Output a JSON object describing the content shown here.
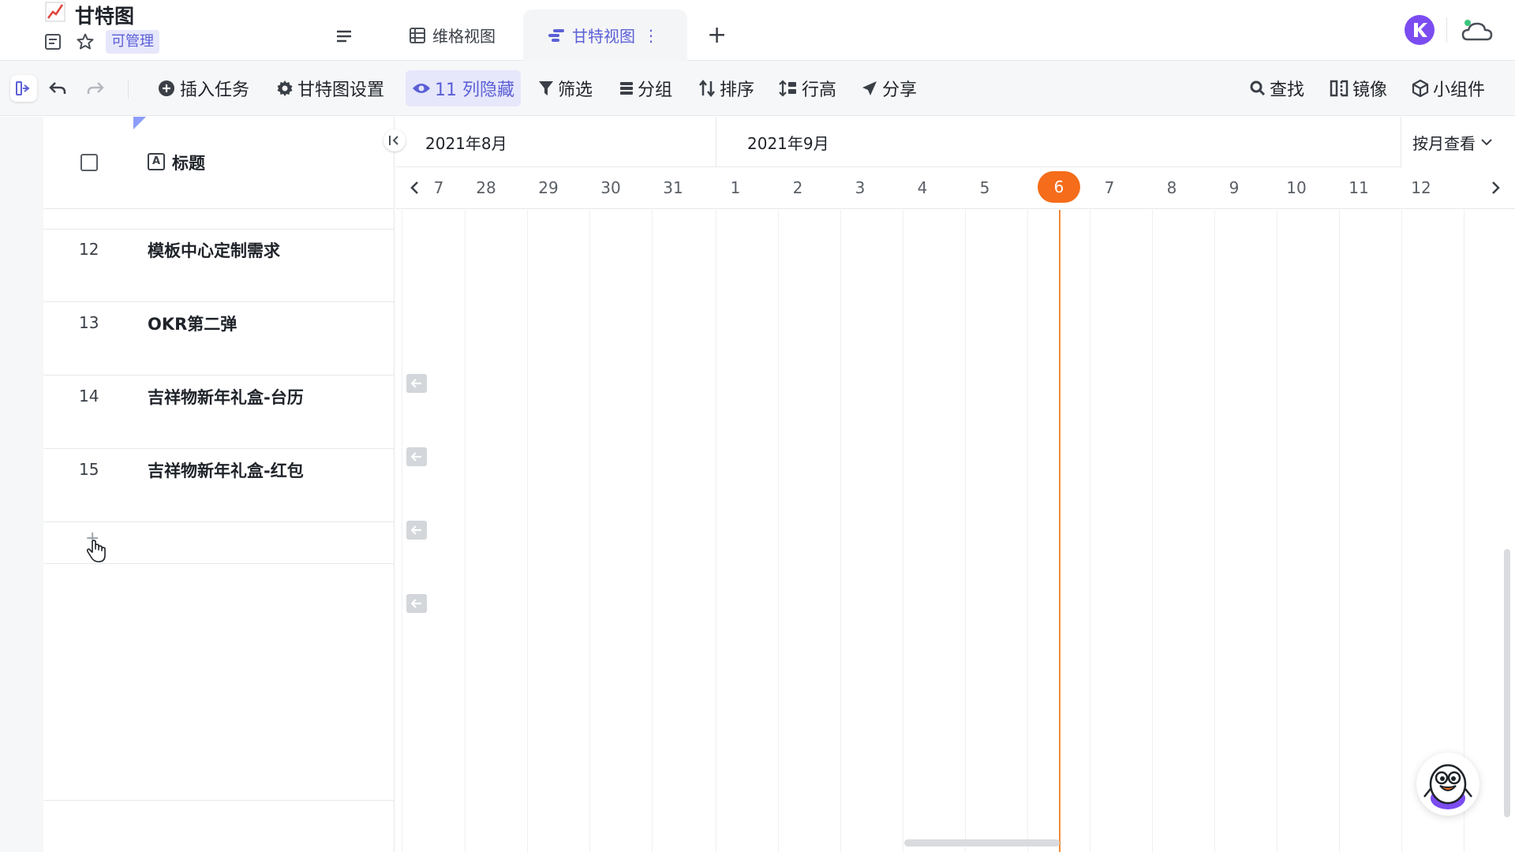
{
  "doc": {
    "title": "甘特图",
    "permission": "可管理"
  },
  "views": {
    "grid_label": "维格视图",
    "gantt_label": "甘特视图",
    "more_glyph": "⋮",
    "add_glyph": "+"
  },
  "toolbar": {
    "insert_task": "插入任务",
    "gantt_settings": "甘特图设置",
    "hidden_columns": "11 列隐藏",
    "filter": "筛选",
    "group": "分组",
    "sort": "排序",
    "row_height": "行高",
    "share": "分享",
    "find": "查找",
    "mirror": "镜像",
    "widget": "小组件"
  },
  "table": {
    "header_title": "标题",
    "header_title_icon": "A",
    "rows": [
      {
        "num": "12",
        "title": "模板中心定制需求"
      },
      {
        "num": "13",
        "title": "OKR第二弹"
      },
      {
        "num": "14",
        "title": "吉祥物新年礼盒-台历"
      },
      {
        "num": "15",
        "title": "吉祥物新年礼盒-红包"
      }
    ],
    "add_glyph": "+"
  },
  "gantt": {
    "months": [
      "2021年8月",
      "2021年9月"
    ],
    "view_mode": "按月查看",
    "days": [
      "7",
      "28",
      "29",
      "30",
      "31",
      "1",
      "2",
      "3",
      "4",
      "5",
      "6",
      "7",
      "8",
      "9",
      "10",
      "11",
      "12"
    ],
    "today": "6"
  },
  "colors": {
    "accent": "#5b5fd6",
    "today": "#f56c1a",
    "active_bg": "#e6e7fb"
  },
  "icons": {
    "doc_emoji": "chart-increasing-icon",
    "cloud": "cloud-icon",
    "avatar": "user-avatar-icon",
    "mascot": "mascot-helper-icon"
  }
}
